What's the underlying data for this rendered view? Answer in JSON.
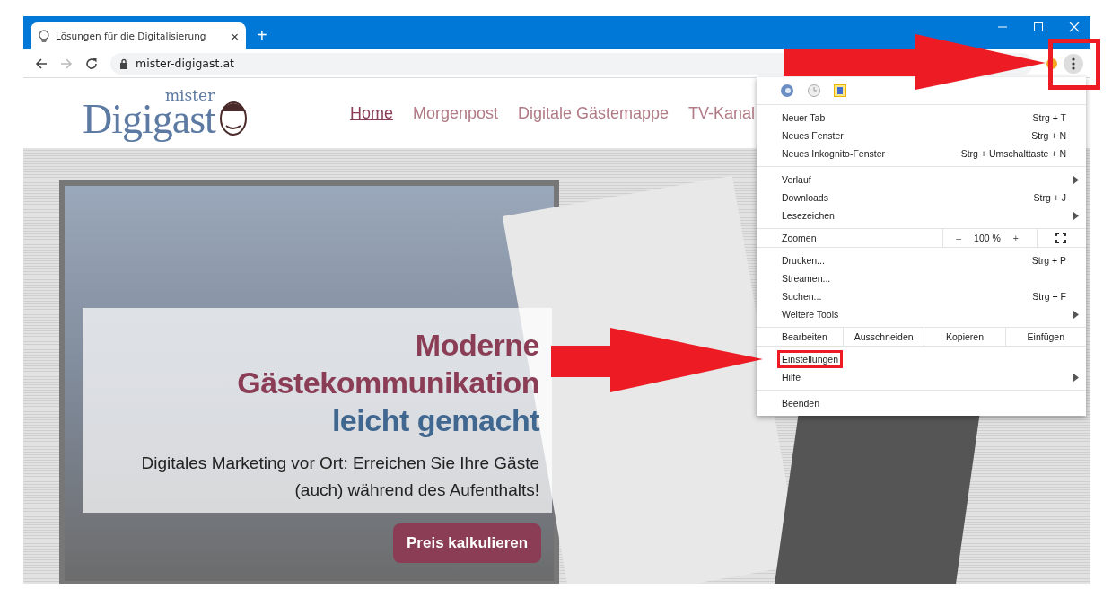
{
  "browser": {
    "tab": {
      "title": "Lösungen für die Digitalisierung",
      "close": "×"
    },
    "new_tab": "+",
    "url": "mister-digigast.at"
  },
  "site": {
    "logo": {
      "small": "mister",
      "large": "Digigast"
    },
    "nav": [
      {
        "label": "Home",
        "selected": true
      },
      {
        "label": "Morgenpost",
        "selected": false
      },
      {
        "label": "Digitale Gästemappe",
        "selected": false
      },
      {
        "label": "TV-Kanal",
        "selected": false
      }
    ],
    "hero": {
      "headline": [
        {
          "text": "Moderne",
          "kind": "accent"
        },
        {
          "text": "Gästekommunikation",
          "kind": "accent"
        },
        {
          "text": "leicht gemacht",
          "kind": "secondary"
        }
      ],
      "subtitle": "Digitales Marketing vor Ort: Erreichen Sie Ihre Gäste (auch) während des Aufenthalts!",
      "cta": "Preis kalkulieren"
    }
  },
  "menu": {
    "groups": [
      [
        {
          "label": "Neuer Tab",
          "shortcut": "Strg + T",
          "submenu": false,
          "highlighted": false
        },
        {
          "label": "Neues Fenster",
          "shortcut": "Strg + N",
          "submenu": false,
          "highlighted": false
        },
        {
          "label": "Neues Inkognito-Fenster",
          "shortcut": "Strg + Umschalttaste + N",
          "submenu": false,
          "highlighted": false
        }
      ],
      [
        {
          "label": "Verlauf",
          "submenu": true,
          "highlighted": false
        },
        {
          "label": "Downloads",
          "shortcut": "Strg + J",
          "submenu": false,
          "highlighted": false
        },
        {
          "label": "Lesezeichen",
          "submenu": true,
          "highlighted": false
        }
      ],
      [
        {
          "kind": "zoom",
          "label": "Zoomen",
          "minus": "–",
          "value": "100 %",
          "plus": "+"
        }
      ],
      [
        {
          "label": "Drucken...",
          "shortcut": "Strg + P",
          "submenu": false,
          "highlighted": false
        },
        {
          "label": "Streamen...",
          "submenu": false,
          "highlighted": false
        },
        {
          "label": "Suchen...",
          "shortcut": "Strg + F",
          "submenu": false,
          "highlighted": false
        },
        {
          "label": "Weitere Tools",
          "submenu": true,
          "highlighted": false
        }
      ],
      [
        {
          "kind": "edit",
          "label": "Bearbeiten",
          "actions": [
            "Ausschneiden",
            "Kopieren",
            "Einfügen"
          ]
        }
      ],
      [
        {
          "label": "Einstellungen",
          "submenu": false,
          "highlighted": true
        },
        {
          "label": "Hilfe",
          "submenu": true,
          "highlighted": false
        }
      ],
      [
        {
          "label": "Beenden",
          "submenu": false,
          "highlighted": false
        }
      ]
    ]
  },
  "annotations": {
    "menu_button_highlighted": true
  }
}
